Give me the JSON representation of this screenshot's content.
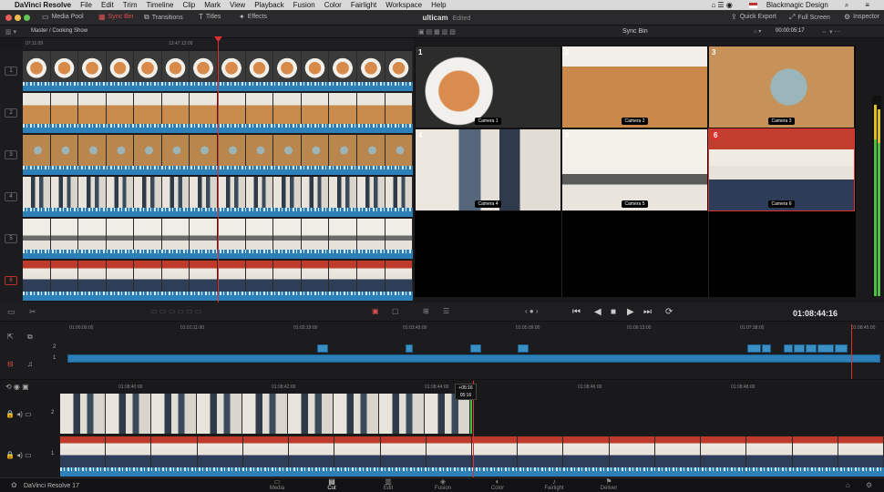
{
  "menubar": {
    "app": "DaVinci Resolve",
    "items": [
      "File",
      "Edit",
      "Trim",
      "Timeline",
      "Clip",
      "Mark",
      "View",
      "Playback",
      "Fusion",
      "Color",
      "Fairlight",
      "Workspace",
      "Help"
    ],
    "right_label": "Blackmagic Design"
  },
  "toolbar": {
    "media_pool": "Media Pool",
    "sync_bin": "Sync Bin",
    "transitions": "Transitions",
    "titles": "Titles",
    "effects": "Effects",
    "project_name": "ulticam",
    "project_status": "Edited",
    "quick_export": "Quick Export",
    "full_screen": "Full Screen",
    "inspector": "Inspector",
    "traffic_colors": [
      "#ec5f5a",
      "#f4bd4f",
      "#61c554"
    ]
  },
  "source": {
    "breadcrumb": "Master / Cooking Show",
    "ruler": [
      "07:11:09",
      "13:47:13:09"
    ],
    "track_numbers": [
      "1",
      "2",
      "3",
      "4",
      "5",
      "6"
    ]
  },
  "viewer": {
    "title": "Sync Bin",
    "timecode_top": "00:00:05:17",
    "timecode": "01:08:44:16",
    "cameras": [
      {
        "num": "1",
        "label": "Camera 1"
      },
      {
        "num": "2",
        "label": "Camera 2"
      },
      {
        "num": "3",
        "label": "Camera 3"
      },
      {
        "num": "4",
        "label": "Camera 4"
      },
      {
        "num": "5",
        "label": "Camera 5"
      },
      {
        "num": "6",
        "label": "Camera 6"
      }
    ]
  },
  "upper_timeline": {
    "ruler": [
      "01:00:00:00",
      "01:01:11:00",
      "01:02:19:00",
      "01:03:45:00",
      "01:05:09:00",
      "01:06:13:00",
      "01:07:38:00",
      "01:08:45:00"
    ],
    "track_numbers": [
      "2",
      "1"
    ]
  },
  "lower_timeline": {
    "ruler": [
      "01:08:40:00",
      "01:08:42:00",
      "01:08:44:00",
      "01:08:46:00",
      "01:08:48:00"
    ],
    "popup_top": "+05:16",
    "popup_bottom": "05:16",
    "track_numbers": [
      "2",
      "1"
    ]
  },
  "footer": {
    "app_name": "DaVinci Resolve 17",
    "pages": [
      "Media",
      "Cut",
      "Edit",
      "Fusion",
      "Color",
      "Fairlight",
      "Deliver"
    ]
  }
}
